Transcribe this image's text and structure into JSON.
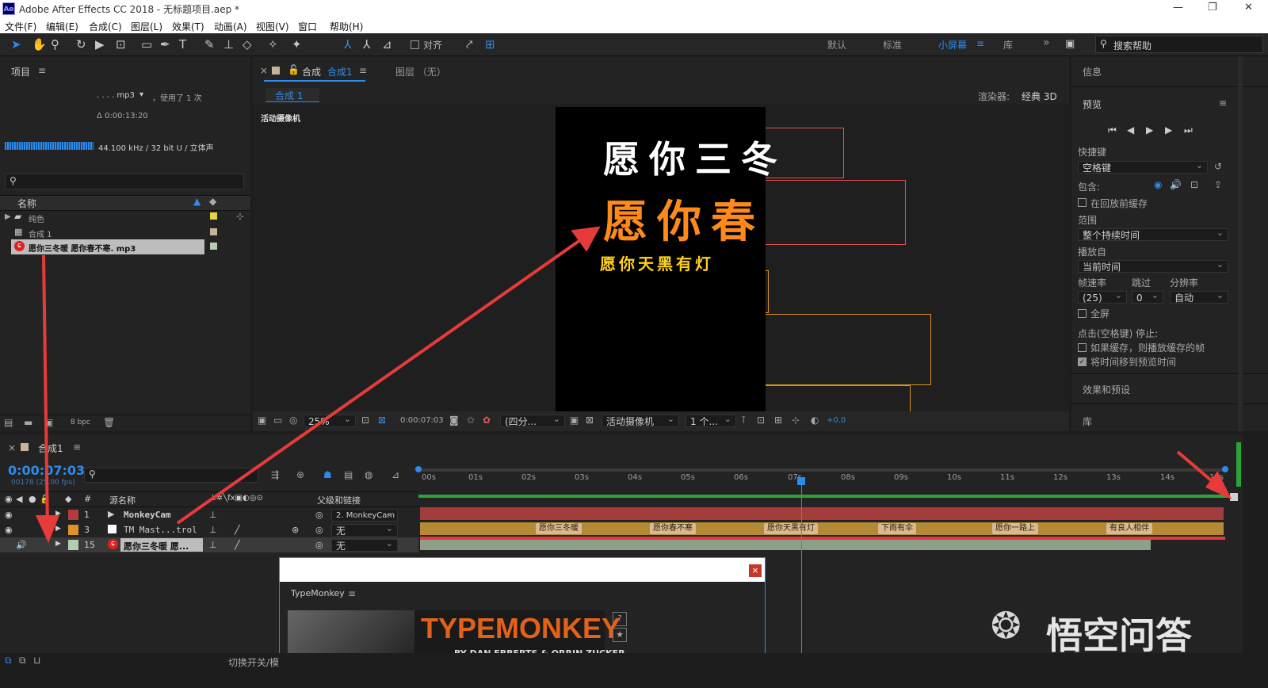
{
  "app": {
    "title": "Adobe After Effects CC 2018 - 无标题项目.aep *",
    "logo": "Ae",
    "win_controls": [
      "—",
      "❐",
      "✕"
    ]
  },
  "menu": [
    "文件(F)",
    "编辑(E)",
    "合成(C)",
    "图层(L)",
    "效果(T)",
    "动画(A)",
    "视图(V)",
    "窗口",
    "帮助(H)"
  ],
  "toolbar": {
    "align_label": "对齐",
    "workspaces": [
      "默认",
      "标准",
      "小屏幕",
      "库"
    ],
    "active_workspace": "小屏幕",
    "more": "»",
    "search_placeholder": "搜索帮助"
  },
  "project": {
    "title": "项目",
    "item_name": ". . . . mp3",
    "used": "，使用了 1 次",
    "duration": "Δ 0:00:13:20",
    "audio_info": "44.100 kHz / 32 bit U / 立体声",
    "col_name": "名称",
    "items": [
      {
        "name": "纯色",
        "icon": "folder-icon",
        "color": "#e6d14a"
      },
      {
        "name": "合成 1",
        "icon": "composition-icon",
        "color": "#c8b29a"
      },
      {
        "name": "愿你三冬暖 愿你春不寒. mp3",
        "icon": "netease-music-icon",
        "color": "#b5ccb1"
      }
    ],
    "bpc": "8 bpc"
  },
  "composition": {
    "tab_title": "合成",
    "tab_name": "合成1",
    "layer_tab": "图层 （无）",
    "subtab": "合成 1",
    "renderer_label": "渲染器:",
    "renderer": "经典 3D",
    "camera_label": "活动摄像机",
    "text_line1": "愿你三冬",
    "text_line2": "愿你春",
    "text_line3": "愿你天黑有灯",
    "zoom": "25%",
    "timecode": "0:00:07:03",
    "resolution": "(四分...",
    "view": "活动摄像机",
    "views_count": "1 个...",
    "exposure": "+0.0"
  },
  "right_panel": {
    "info": "信息",
    "preview": "预览",
    "shortcut_label": "快捷键",
    "shortcut_value": "空格键",
    "include_label": "包含:",
    "cache_before": "在回放前缓存",
    "range_label": "范围",
    "range_value": "整个持续时间",
    "play_from_label": "播放自",
    "play_from_value": "当前时间",
    "fps_label": "帧速率",
    "skip_label": "跳过",
    "res_label": "分辨率",
    "fps_value": "(25)",
    "skip_value": "0",
    "res_value": "自动",
    "fullscreen": "全屏",
    "stop_label": "点击(空格键) 停止:",
    "opt1": "如果缓存，则播放缓存的帧",
    "opt2": "将时间移到预览时间",
    "effects": "效果和预设",
    "library": "库"
  },
  "timeline": {
    "comp_name": "合成1",
    "timecode": "0:00:07:03",
    "frame_info": "00178 (25.00 fps)",
    "cols": {
      "num": "#",
      "source": "源名称",
      "parent": "父级和链接"
    },
    "ruler": [
      "00s",
      "01s",
      "02s",
      "03s",
      "04s",
      "05s",
      "06s",
      "07s",
      "08s",
      "09s",
      "10s",
      "11s",
      "12s",
      "13s",
      "14s",
      "15s"
    ],
    "layers": [
      {
        "num": "1",
        "name": "MonkeyCam",
        "color": "#b23b3b",
        "parent": "2. MonkeyCam"
      },
      {
        "num": "3",
        "name": "TM Mast...trol",
        "color": "#e0922a",
        "parent": "无"
      },
      {
        "num": "15",
        "name": "愿你三冬暖 愿...",
        "color": "#b5ccb1",
        "parent": "无"
      }
    ],
    "markers": [
      "愿你三冬暖",
      "愿你春不寒",
      "愿你天黑有灯",
      "下雨有伞",
      "愿你一路上",
      "有良人相伴"
    ],
    "toggle": "切换开关/模"
  },
  "typemonkey": {
    "title": "TypeMonkey",
    "banner_title": "TYPEMONKEY",
    "banner_sub": "BY DAN EBBERTS & ORRIN ZUCKER",
    "help": "?",
    "close": "×"
  },
  "watermark": {
    "text": "悟空问答"
  },
  "colors": {
    "accent": "#2d8ceb",
    "annotation_red": "#e63b3b",
    "orange_text": "#ff8a1a",
    "yellow_text": "#ffd11a"
  }
}
